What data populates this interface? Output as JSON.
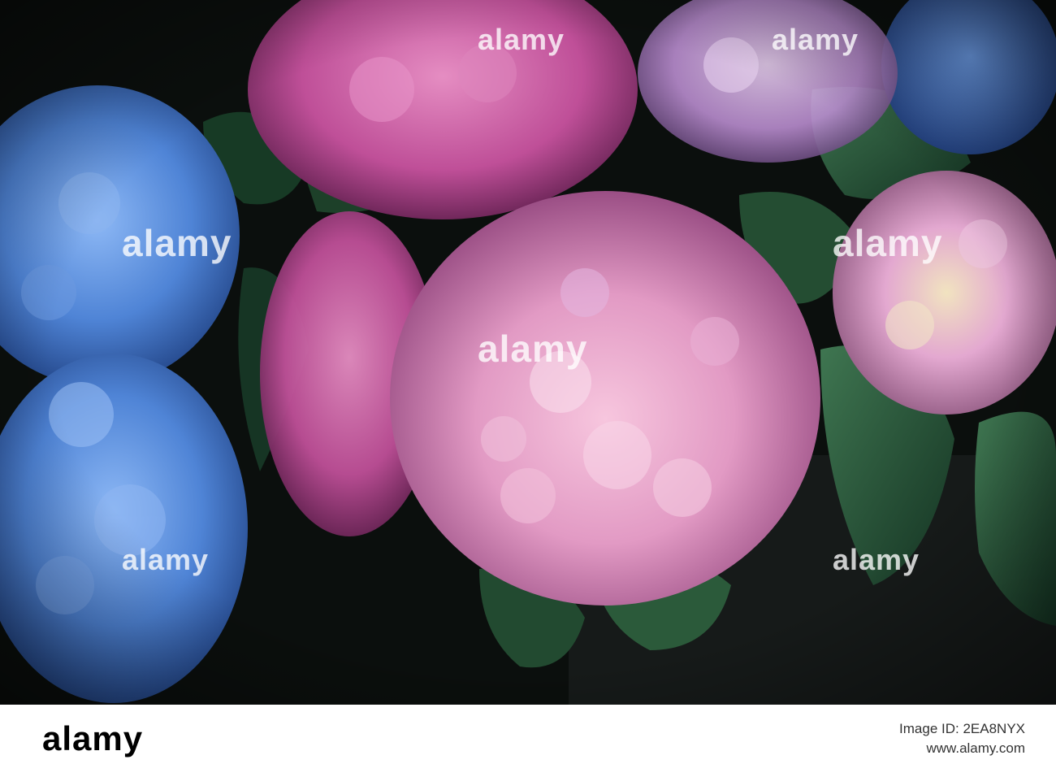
{
  "image": {
    "subject": "hydrangea-flowers",
    "colors": {
      "blue": "#4f84d6",
      "pink": "#e69ac6",
      "magenta": "#cc5aa5",
      "lavender": "#c9a6dc",
      "leaf": "#1f4a30",
      "background": "#0b0f0d"
    }
  },
  "watermark": {
    "text": "alamy"
  },
  "footer": {
    "logo": "alamy",
    "line1": "Image ID: 2EA8NYX",
    "line2": "www.alamy.com"
  }
}
